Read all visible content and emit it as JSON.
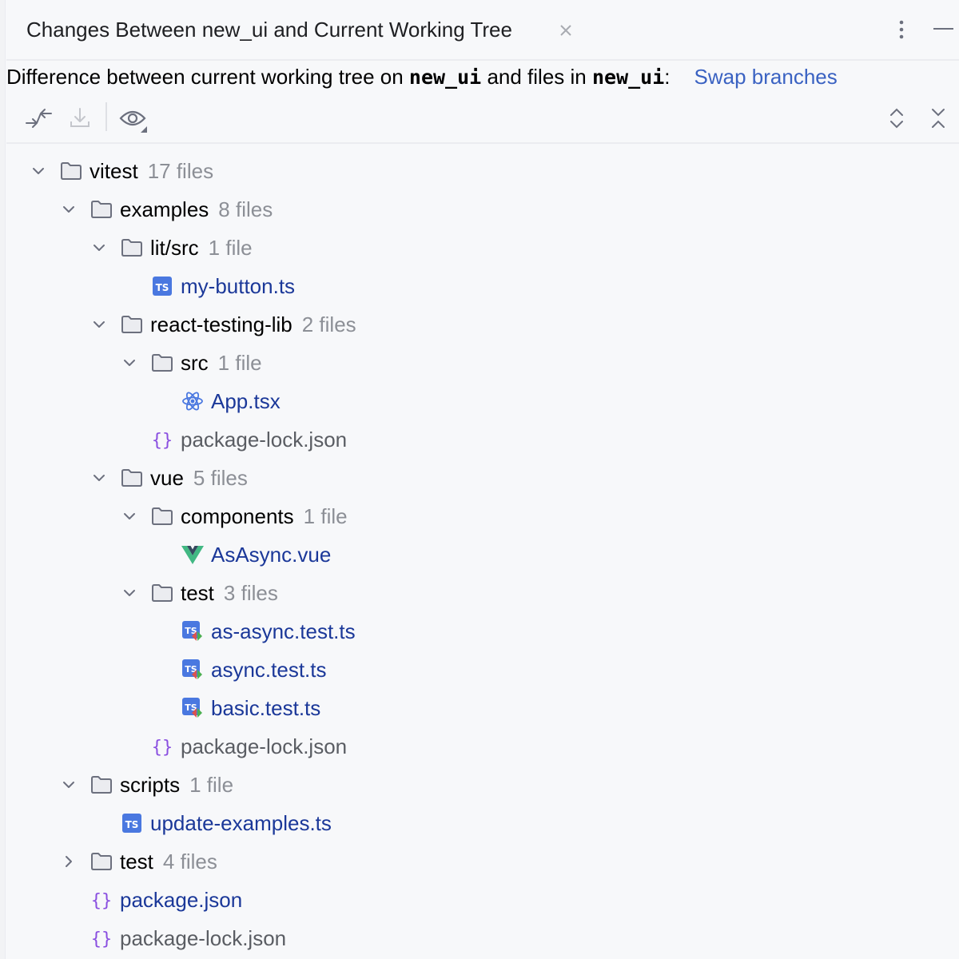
{
  "header": {
    "title": "Changes Between new_ui and Current Working Tree",
    "close_icon": "close-icon",
    "more_icon": "more-vertical-icon",
    "minimize_icon": "minimize-icon"
  },
  "description": {
    "prefix": "Difference between current working tree on ",
    "branch1": "new_ui",
    "middle": " and files in ",
    "branch2": "new_ui",
    "suffix": ":",
    "swap_link": "Swap branches"
  },
  "toolbar": {
    "left": [
      {
        "icon": "compare-arrows-icon",
        "enabled": true
      },
      {
        "icon": "download-icon",
        "enabled": false
      },
      {
        "icon": "eye-view-options-icon",
        "enabled": true
      }
    ],
    "right": [
      {
        "icon": "expand-all-icon"
      },
      {
        "icon": "collapse-all-icon"
      }
    ]
  },
  "colors": {
    "background": "#f7f8fa",
    "link": "#3a62c2",
    "modified_file": "#1b3899",
    "unmodified_file": "#5a5d63",
    "count": "#8c8f96",
    "ts_icon": "#4a78e0",
    "json_icon": "#8a4fe0",
    "vue_icon": "#41b883"
  },
  "tree": [
    {
      "level": 0,
      "type": "folder",
      "expanded": true,
      "name": "vitest",
      "count": "17 files"
    },
    {
      "level": 1,
      "type": "folder",
      "expanded": true,
      "name": "examples",
      "count": "8 files"
    },
    {
      "level": 2,
      "type": "folder",
      "expanded": true,
      "name": "lit/src",
      "count": "1 file"
    },
    {
      "level": 3,
      "type": "ts",
      "name": "my-button.ts",
      "status": "modified"
    },
    {
      "level": 2,
      "type": "folder",
      "expanded": true,
      "name": "react-testing-lib",
      "count": "2 files"
    },
    {
      "level": 3,
      "type": "folder",
      "expanded": true,
      "name": "src",
      "count": "1 file"
    },
    {
      "level": 4,
      "type": "react",
      "name": "App.tsx",
      "status": "modified"
    },
    {
      "level": 3,
      "type": "json",
      "name": "package-lock.json",
      "status": "plain"
    },
    {
      "level": 2,
      "type": "folder",
      "expanded": true,
      "name": "vue",
      "count": "5 files"
    },
    {
      "level": 3,
      "type": "folder",
      "expanded": true,
      "name": "components",
      "count": "1 file"
    },
    {
      "level": 4,
      "type": "vue",
      "name": "AsAsync.vue",
      "status": "modified"
    },
    {
      "level": 3,
      "type": "folder",
      "expanded": true,
      "name": "test",
      "count": "3 files"
    },
    {
      "level": 4,
      "type": "ts-test",
      "name": "as-async.test.ts",
      "status": "modified"
    },
    {
      "level": 4,
      "type": "ts-test",
      "name": "async.test.ts",
      "status": "modified"
    },
    {
      "level": 4,
      "type": "ts-test",
      "name": "basic.test.ts",
      "status": "modified"
    },
    {
      "level": 3,
      "type": "json",
      "name": "package-lock.json",
      "status": "plain"
    },
    {
      "level": 1,
      "type": "folder",
      "expanded": true,
      "name": "scripts",
      "count": "1 file"
    },
    {
      "level": 2,
      "type": "ts",
      "name": "update-examples.ts",
      "status": "modified"
    },
    {
      "level": 1,
      "type": "folder",
      "expanded": false,
      "name": "test",
      "count": "4 files"
    },
    {
      "level": 1,
      "type": "json",
      "name": "package.json",
      "status": "modified"
    },
    {
      "level": 1,
      "type": "json",
      "name": "package-lock.json",
      "status": "plain"
    }
  ]
}
